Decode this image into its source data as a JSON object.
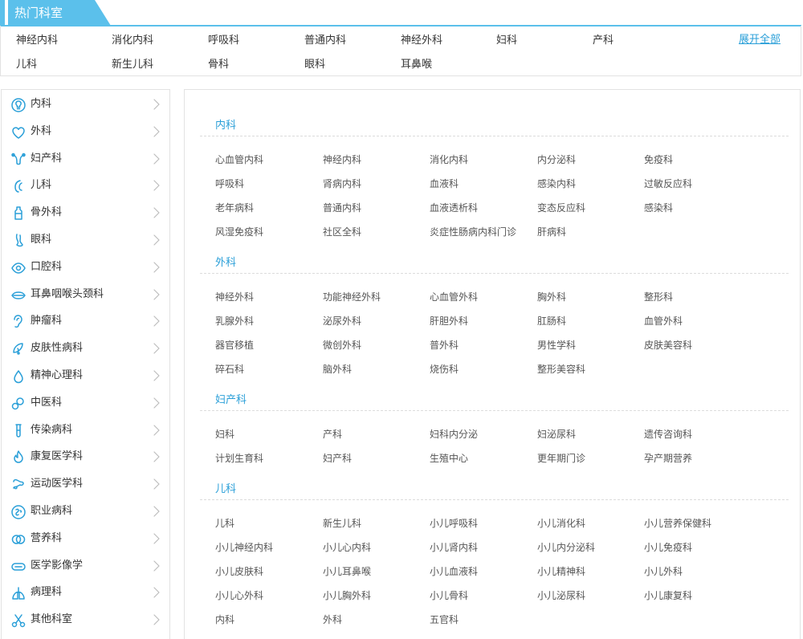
{
  "hot": {
    "title": "热门科室",
    "items": [
      "神经内科",
      "消化内科",
      "呼吸科",
      "普通内科",
      "神经外科",
      "妇科",
      "产科",
      "儿科",
      "新生儿科",
      "骨科",
      "眼科",
      "耳鼻喉"
    ],
    "more_label": "展开全部",
    "accent_color": "#5bc0eb"
  },
  "sidebar": {
    "items": [
      {
        "label": "内科",
        "icon": "lightbulb-icon"
      },
      {
        "label": "外科",
        "icon": "heart-icon"
      },
      {
        "label": "妇产科",
        "icon": "uterus-icon"
      },
      {
        "label": "儿科",
        "icon": "infant-icon"
      },
      {
        "label": "骨外科",
        "icon": "bottle-icon"
      },
      {
        "label": "眼科",
        "icon": "foot-icon"
      },
      {
        "label": "口腔科",
        "icon": "eye-icon"
      },
      {
        "label": "耳鼻咽喉头颈科",
        "icon": "lips-icon"
      },
      {
        "label": "肿瘤科",
        "icon": "ear-icon"
      },
      {
        "label": "皮肤性病科",
        "icon": "skin-icon"
      },
      {
        "label": "精神心理科",
        "icon": "drop-icon"
      },
      {
        "label": "中医科",
        "icon": "herb-icon"
      },
      {
        "label": "传染病科",
        "icon": "test-tube-icon"
      },
      {
        "label": "康复医学科",
        "icon": "flame-icon"
      },
      {
        "label": "运动医学科",
        "icon": "joint-icon"
      },
      {
        "label": "职业病科",
        "icon": "circle-brain-icon"
      },
      {
        "label": "营养科",
        "icon": "rings-icon"
      },
      {
        "label": "医学影像学",
        "icon": "capsule-icon"
      },
      {
        "label": "病理科",
        "icon": "lungs-icon"
      },
      {
        "label": "其他科室",
        "icon": "scissors-icon"
      }
    ]
  },
  "main": {
    "sections": [
      {
        "title": "内科",
        "items": [
          "心血管内科",
          "神经内科",
          "消化内科",
          "内分泌科",
          "免疫科",
          "呼吸科",
          "肾病内科",
          "血液科",
          "感染内科",
          "过敏反应科",
          "老年病科",
          "普通内科",
          "血液透析科",
          "变态反应科",
          "感染科",
          "风湿免疫科",
          "社区全科",
          "炎症性肠病内科门诊",
          "肝病科"
        ]
      },
      {
        "title": "外科",
        "items": [
          "神经外科",
          "功能神经外科",
          "心血管外科",
          "胸外科",
          "整形科",
          "乳腺外科",
          "泌尿外科",
          "肝胆外科",
          "肛肠科",
          "血管外科",
          "器官移植",
          "微创外科",
          "普外科",
          "男性学科",
          "皮肤美容科",
          "碎石科",
          "脑外科",
          "烧伤科",
          "整形美容科"
        ]
      },
      {
        "title": "妇产科",
        "items": [
          "妇科",
          "产科",
          "妇科内分泌",
          "妇泌尿科",
          "遗传咨询科",
          "计划生育科",
          "妇产科",
          "生殖中心",
          "更年期门诊",
          "孕产期营养"
        ]
      },
      {
        "title": "儿科",
        "items": [
          "儿科",
          "新生儿科",
          "小儿呼吸科",
          "小儿消化科",
          "小儿营养保健科",
          "小儿神经内科",
          "小儿心内科",
          "小儿肾内科",
          "小儿内分泌科",
          "小儿免疫科",
          "小儿皮肤科",
          "小儿耳鼻喉",
          "小儿血液科",
          "小儿精神科",
          "小儿外科",
          "小儿心外科",
          "小儿胸外科",
          "小儿骨科",
          "小儿泌尿科",
          "小儿康复科",
          "内科",
          "外科",
          "五官科"
        ]
      }
    ],
    "accent_color": "#2a9fd8",
    "icon_color": "#2a9fd8"
  }
}
